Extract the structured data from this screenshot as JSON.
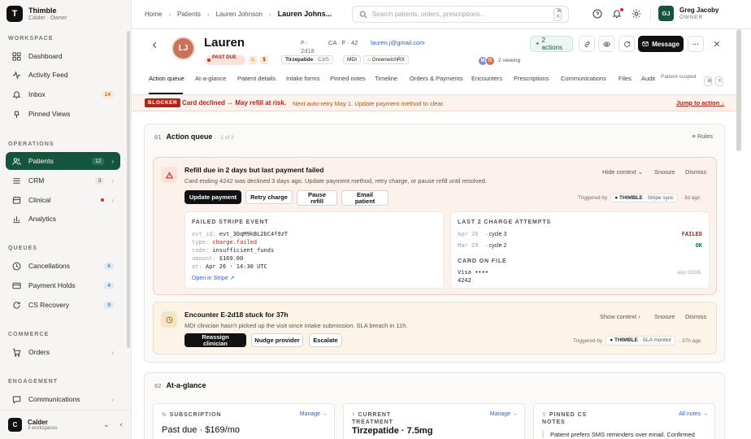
{
  "app": {
    "name": "Thimble",
    "sub": "Calder · Owner"
  },
  "sidebar": {
    "sections": {
      "workspace": "WORKSPACE",
      "operations": "OPERATIONS",
      "queues": "QUEUES",
      "commerce": "COMMERCE",
      "engagement": "ENGAGEMENT"
    },
    "items": {
      "dashboard": "Dashboard",
      "activity": "Activity Feed",
      "inbox": "Inbox",
      "inbox_count": "14",
      "pinned": "Pinned Views",
      "patients": "Patients",
      "patients_count": "12",
      "crm": "CRM",
      "crm_count": "3",
      "clinical": "Clinical",
      "analytics": "Analytics",
      "cancellations": "Cancellations",
      "cancellations_count": "6",
      "payment_holds": "Payment Holds",
      "payment_holds_count": "4",
      "cs_recovery": "CS Recovery",
      "cs_recovery_count": "9",
      "orders": "Orders",
      "communications": "Communications"
    },
    "workspace": {
      "initial": "C",
      "name": "Calder",
      "sub": "3 workspaces"
    }
  },
  "topbar": {
    "crumbs": [
      "Home",
      "Patients",
      "Lauren Johnson",
      "Lauren Johns..."
    ],
    "search_placeholder": "Search patients, orders, prescriptions...",
    "kbd": "⌘ K",
    "user": {
      "initials": "GJ",
      "name": "Greg Jacoby",
      "role": "OWNER"
    }
  },
  "patient": {
    "initials": "LJ",
    "name": "Lauren",
    "id_line1": "P-",
    "id_line2": "2d18",
    "demo": "CA · F · 42",
    "email": "lauren.j@gmail.com",
    "status": "PAST DUE",
    "dollar": "$",
    "med": "Tirzepatide",
    "med_cycle": "· C3/5",
    "provider": "MDI",
    "pharmacy": "GreenwichRX",
    "viewers": [
      {
        "i": "M",
        "c": "#7c8fc9"
      },
      {
        "i": "G",
        "c": "#c9735a"
      }
    ],
    "viewing": "2 viewing"
  },
  "header_actions": {
    "actions": "2 actions",
    "message": "Message"
  },
  "tabs": [
    "Action queue",
    "At-a-glance",
    "Patient details",
    "Intake forms",
    "Pinned notes",
    "Timeline",
    "Orders & Payments",
    "Encounters",
    "Prescriptions",
    "Communications",
    "Files",
    "Audit"
  ],
  "tabs_extra": {
    "scoped": "Patient-scoped",
    "k1": "⌘",
    "k2": "K"
  },
  "banner": {
    "tag": "BLOCKER",
    "title": "Card declined → May refill at risk.",
    "sub": "Next auto-retry May 1. Update payment method to clear.",
    "jump": "Jump to action ↓"
  },
  "action_queue": {
    "num": "01",
    "title": "Action queue",
    "count": "· 2 of 2",
    "rules": "Rules",
    "card1": {
      "title": "Refill due in 2 days but last payment failed",
      "sub": "Card ending 4242 was declined 3 days ago. Update payment method, retry charge, or pause refill until resolved.",
      "hide": "Hide context",
      "snooze": "Snooze",
      "dismiss": "Dismiss",
      "buttons": [
        "Update payment",
        "Retry charge",
        "Pause refill",
        "Email patient"
      ],
      "trig_label": "Triggered by",
      "trig_app": "● THIMBLE",
      "trig_src": "· Stripe sync",
      "trig_time": "· 3d ago",
      "event": {
        "head": "FAILED STRIPE EVENT",
        "id_k": "evt_id:",
        "id_v": "evt_3OqM9kBL2bC4f9zT",
        "type_k": "type:",
        "type_v": "charge.failed",
        "code_k": "code:",
        "code_v": "insufficient_funds",
        "amt_k": "amount:",
        "amt_v": "$169.00",
        "at_k": "at:",
        "at_v": "Apr 26 · 14:30 UTC",
        "link": "Open in Stripe ↗"
      },
      "attempts": {
        "head": "LAST 2 CHARGE ATTEMPTS",
        "rows": [
          {
            "date": "Apr 26",
            "cycle": "· cycle 3",
            "status": "FAILED"
          },
          {
            "date": "Mar 29",
            "cycle": "· cycle 2",
            "status": "OK"
          }
        ]
      },
      "card": {
        "head": "CARD ON FILE",
        "brand": "Visa ••••",
        "last4": "4242",
        "exp": "exp 03/26"
      }
    },
    "card2": {
      "title": "Encounter E-2d18 stuck for 37h",
      "sub": "MDI clinician hasn't picked up the visit since intake submission. SLA breach in 11h.",
      "show": "Show context",
      "snooze": "Snooze",
      "dismiss": "Dismiss",
      "buttons": [
        "Reassign clinician",
        "Nudge provider",
        "Escalate"
      ],
      "trig_label": "Triggered by",
      "trig_app": "● THIMBLE",
      "trig_src": "· SLA monitor",
      "trig_time": "· 37h ago"
    }
  },
  "glance": {
    "num": "02",
    "title": "At-a-glance",
    "cards": [
      {
        "head": "SUBSCRIPTION",
        "value": "Past due · $169/mo",
        "action": "Manage →"
      },
      {
        "head": "CURRENT TREATMENT",
        "value": "Tirzepatide · 7.5mg",
        "action": "Manage →"
      },
      {
        "head": "PINNED CS NOTES",
        "value": "Patient prefers SMS reminders over email. Confirmed",
        "action": "All notes →"
      }
    ]
  },
  "colors": {
    "brand": "#14553f",
    "danger": "#b42318",
    "link": "#2563eb"
  }
}
